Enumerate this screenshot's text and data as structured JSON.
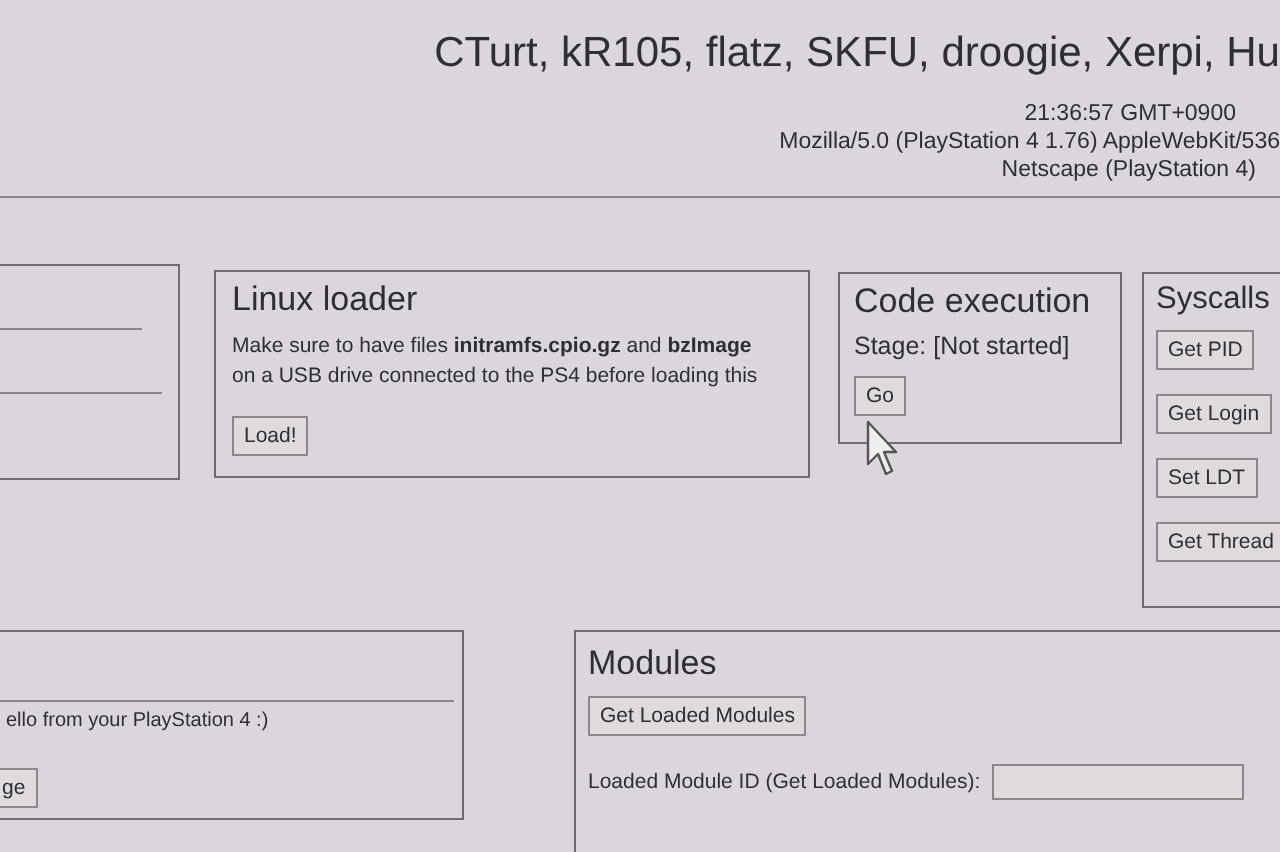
{
  "header": {
    "credits": "CTurt, kR105, flatz, SKFU, droogie, Xerpi, Hu",
    "time": "21:36:57 GMT+0900",
    "user_agent": "Mozilla/5.0 (PlayStation 4 1.76) AppleWebKit/536",
    "app_name": "Netscape (PlayStation 4)"
  },
  "linux_loader": {
    "title": "Linux loader",
    "text": "Make sure to have files **initramfs.cpio.gz** and **bzImage**\non a USB drive connected to the PS4 before loading this",
    "button": "Load!"
  },
  "code_execution": {
    "title": "Code execution",
    "stage": "Stage: [Not started]",
    "button": "Go"
  },
  "syscalls": {
    "title": "Syscalls",
    "buttons": [
      "Get PID",
      "Get Login",
      "Set LDT",
      "Get Thread"
    ]
  },
  "messages": {
    "text": "ello from your PlayStation 4 :)",
    "button": "ge"
  },
  "modules": {
    "title": "Modules",
    "button": "Get Loaded Modules",
    "id_label": "Loaded Module ID (Get Loaded Modules):"
  }
}
